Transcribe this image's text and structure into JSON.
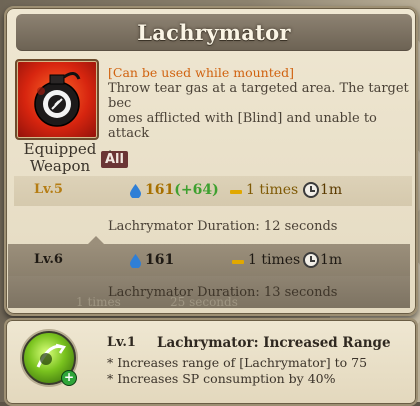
{
  "skill": {
    "title": "Lachrymator",
    "equipped_label": "Equipped Weapon",
    "all_badge": "All",
    "mounted_note": "[Can be used while mounted]",
    "description": "Throw tear gas at a targeted area. The target bec\nomes afflicted with [Blind] and unable to attack\n.",
    "icon": "tear-gas-grenade-icon"
  },
  "levels": [
    {
      "level": "Lv.5",
      "sp": "161",
      "sp_bonus": "(+64)",
      "times": "1 times",
      "cooldown": "1m",
      "duration": "Lachrymator Duration: 12 seconds"
    },
    {
      "level": "Lv.6",
      "sp": "161",
      "times": "1 times",
      "cooldown": "1m",
      "duration": "Lachrymator Duration: 13 seconds"
    }
  ],
  "ghost": {
    "times": "1 times",
    "seconds": "25 seconds"
  },
  "upgrade": {
    "level": "Lv.1",
    "title": "Lachrymator: Increased Range",
    "lines": [
      "* Increases range of  [Lachrymator] to 75",
      "* Increases SP consumption by 40%"
    ],
    "icon": "range-upgrade-icon"
  },
  "colors": {
    "accent_orange": "#d0620f",
    "sp_bonus_green": "#3ea02f",
    "level_gold": "#b57d14"
  }
}
